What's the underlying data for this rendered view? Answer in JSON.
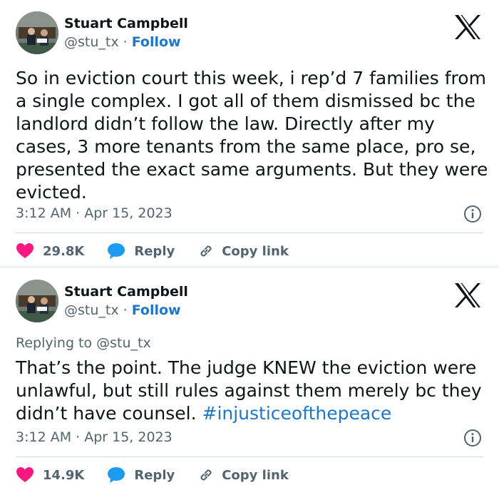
{
  "colors": {
    "text": "#0f1419",
    "secondary": "#536471",
    "link": "#1d77c9",
    "heart": "#f91880",
    "reply": "#1d9bf0",
    "divider": "#cfd9de"
  },
  "icons": [
    "x-logo-icon",
    "info-icon",
    "heart-icon",
    "reply-bubble-icon",
    "link-chain-icon"
  ],
  "tweets": [
    {
      "author": {
        "name": "Stuart Campbell",
        "handle": "@stu_tx",
        "separator": " · ",
        "follow_label": "Follow"
      },
      "text": "So in eviction court this week, i rep’d 7 families from a single complex. I got all of them dismissed bc the landlord didn’t follow the law. Directly after my cases, 3 more tenants from the same place, pro se, presented the exact same arguments. But they were evicted.",
      "timestamp": "3:12 AM · Apr 15, 2023",
      "actions": {
        "likes": "29.8K",
        "reply_label": "Reply",
        "copy_label": "Copy link"
      }
    },
    {
      "author": {
        "name": "Stuart Campbell",
        "handle": "@stu_tx",
        "separator": " · ",
        "follow_label": "Follow"
      },
      "replying_to": "Replying to @stu_tx",
      "text_plain": "That’s the point. The judge KNEW the eviction were unlawful, but still rules against them merely bc they didn’t have counsel. ",
      "hashtag": "#injusticeofthepeace",
      "timestamp": "3:12 AM · Apr 15, 2023",
      "actions": {
        "likes": "14.9K",
        "reply_label": "Reply",
        "copy_label": "Copy link"
      }
    }
  ]
}
